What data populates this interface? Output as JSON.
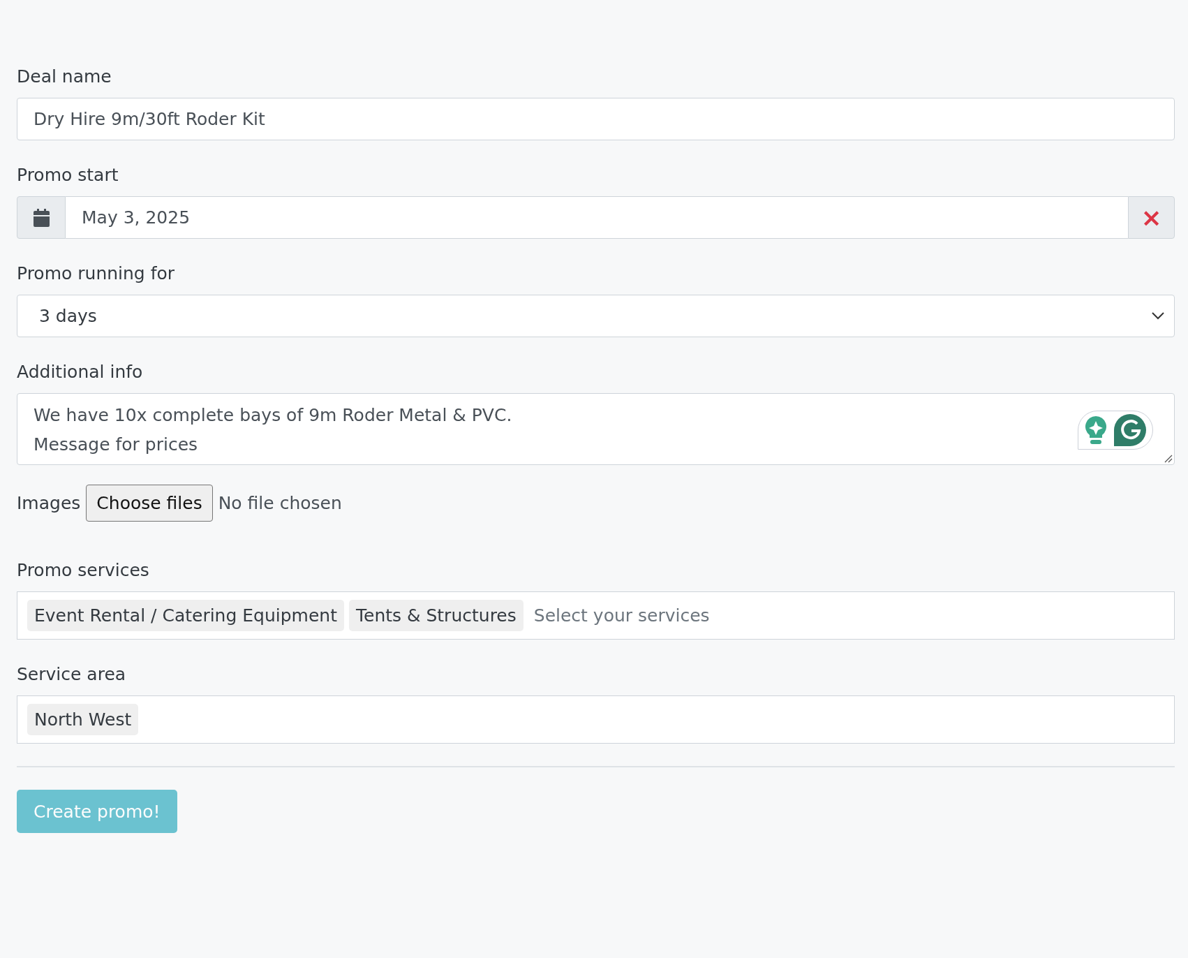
{
  "form": {
    "fields": [
      {
        "kind": "text",
        "label": "Deal name",
        "value": "Dry Hire 9m/30ft Roder Kit"
      },
      {
        "kind": "date",
        "label": "Promo start",
        "value": "May 3, 2025",
        "clear": "×"
      },
      {
        "kind": "select",
        "label": "Promo running for",
        "value": "3 days"
      },
      {
        "kind": "textarea",
        "label": "Additional info",
        "value": "We have 10x complete bays of 9m Roder Metal & PVC.\nMessage for prices"
      },
      {
        "kind": "file",
        "label": "Images",
        "button": "Choose files",
        "status": "No file chosen"
      },
      {
        "kind": "tags",
        "label": "Promo services",
        "tags": [
          "Event Rental / Catering Equipment",
          "Tents & Structures"
        ],
        "placeholder": "Select your services"
      },
      {
        "kind": "tags",
        "label": "Service area",
        "tags": [
          "North West"
        ]
      }
    ],
    "submit": {
      "label": "Create promo!",
      "disabled": true
    }
  }
}
